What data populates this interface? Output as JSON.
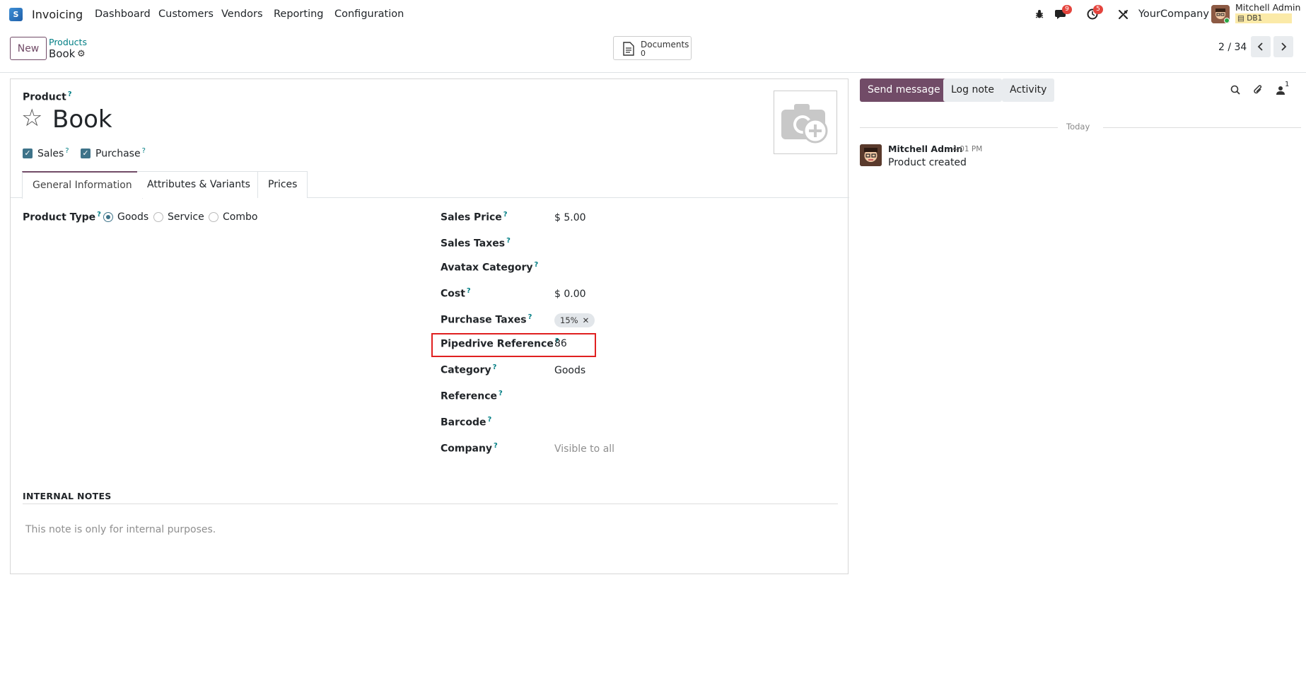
{
  "navbar": {
    "app_logo": "S",
    "app_name": "Invoicing",
    "menu": [
      "Dashboard",
      "Customers",
      "Vendors",
      "Reporting",
      "Configuration"
    ],
    "icons": [
      "bug-icon",
      "chat-icon",
      "clock-icon",
      "tools-icon"
    ],
    "chat_badge": "9",
    "activity_badge": "5",
    "company": "YourCompany",
    "user_name": "Mitchell Admin",
    "db_name": "DB1"
  },
  "control_panel": {
    "new_label": "New",
    "breadcrumb_parent": "Products",
    "breadcrumb_current": "Book",
    "documents_label": "Documents",
    "documents_count": "0",
    "pager": "2 / 34"
  },
  "form": {
    "product_label": "Product",
    "help_mark": "?",
    "title": "Book",
    "sales_label": "Sales",
    "purchase_label": "Purchase",
    "tabs": [
      "General Information",
      "Attributes & Variants",
      "Prices"
    ],
    "active_tab": "General Information",
    "product_type_label": "Product Type",
    "product_type_options": [
      "Goods",
      "Service",
      "Combo"
    ],
    "product_type_selected": "Goods",
    "fields": {
      "sales_price": {
        "label": "Sales Price",
        "value": "$ 5.00"
      },
      "sales_taxes": {
        "label": "Sales Taxes",
        "value": ""
      },
      "avatax_category": {
        "label": "Avatax Category",
        "value": ""
      },
      "cost": {
        "label": "Cost",
        "value": "$ 0.00"
      },
      "purchase_taxes": {
        "label": "Purchase Taxes",
        "tag": "15%"
      },
      "pipedrive_reference": {
        "label": "Pipedrive Reference",
        "value": "86"
      },
      "category": {
        "label": "Category",
        "value": "Goods"
      },
      "reference": {
        "label": "Reference",
        "value": ""
      },
      "barcode": {
        "label": "Barcode",
        "value": ""
      },
      "company": {
        "label": "Company",
        "placeholder": "Visible to all"
      }
    },
    "internal_notes_title": "INTERNAL NOTES",
    "internal_notes_placeholder": "This note is only for internal purposes."
  },
  "chatter": {
    "send_message": "Send message",
    "log_note": "Log note",
    "activity": "Activity",
    "followers_count": "1",
    "day_separator": "Today",
    "messages": [
      {
        "author": "Mitchell Admin",
        "time": "4:01 PM",
        "body": "Product created"
      }
    ]
  },
  "colors": {
    "brand": "#714b67",
    "link": "#017e84",
    "checkbox": "#3e7389",
    "highlight": "#e02020",
    "badge": "#e4443d"
  }
}
